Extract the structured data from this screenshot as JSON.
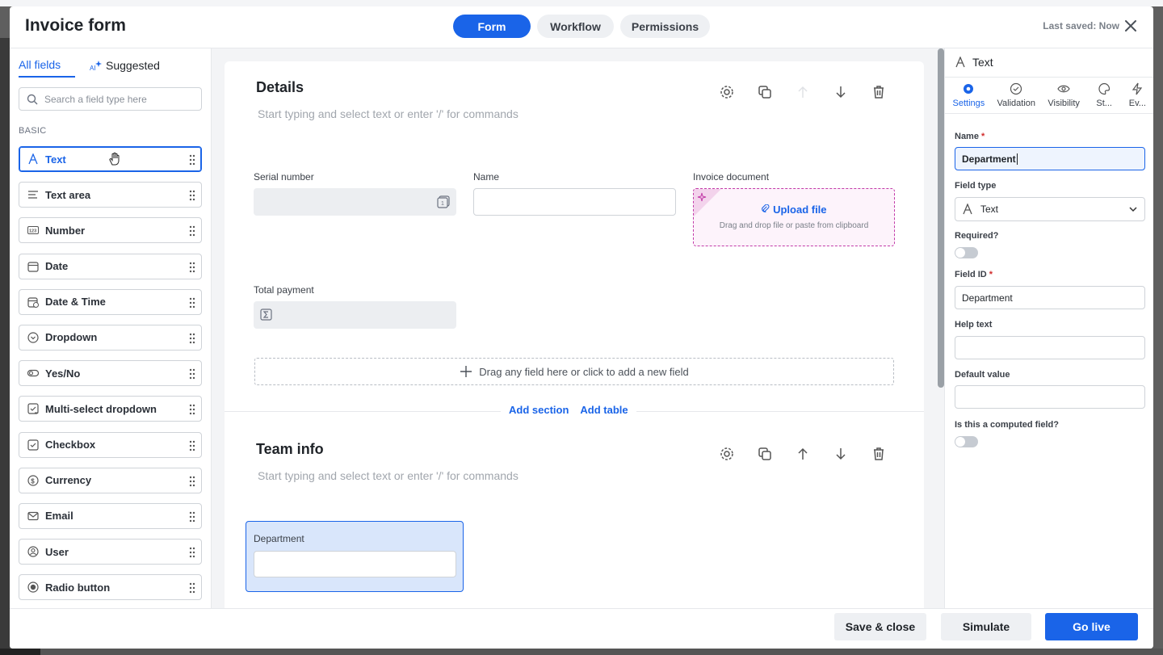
{
  "header": {
    "title": "Invoice form",
    "tabs": [
      {
        "label": "Form"
      },
      {
        "label": "Workflow"
      },
      {
        "label": "Permissions"
      }
    ],
    "last_saved": "Last saved: Now"
  },
  "left_panel": {
    "tabs": [
      {
        "label": "All fields"
      },
      {
        "label": "Suggested"
      }
    ],
    "search_placeholder": "Search a field type here",
    "section_label": "BASIC",
    "fields": [
      {
        "label": "Text",
        "icon": "text-icon"
      },
      {
        "label": "Text area",
        "icon": "text-area-icon"
      },
      {
        "label": "Number",
        "icon": "number-icon"
      },
      {
        "label": "Date",
        "icon": "date-icon"
      },
      {
        "label": "Date & Time",
        "icon": "date-time-icon"
      },
      {
        "label": "Dropdown",
        "icon": "dropdown-icon"
      },
      {
        "label": "Yes/No",
        "icon": "toggle-icon"
      },
      {
        "label": "Multi-select dropdown",
        "icon": "multi-select-icon"
      },
      {
        "label": "Checkbox",
        "icon": "checkbox-icon"
      },
      {
        "label": "Currency",
        "icon": "currency-icon"
      },
      {
        "label": "Email",
        "icon": "email-icon"
      },
      {
        "label": "User",
        "icon": "user-icon"
      },
      {
        "label": "Radio button",
        "icon": "radio-icon"
      }
    ]
  },
  "canvas": {
    "sections": [
      {
        "title": "Details",
        "hint": "Start typing and select text or enter '/' for commands",
        "fields": [
          {
            "label": "Serial number"
          },
          {
            "label": "Name"
          },
          {
            "label": "Invoice document"
          },
          {
            "label": "Total payment"
          }
        ],
        "upload_label": "Upload file",
        "upload_hint": "Drag and drop file or paste from clipboard",
        "dropzone": "Drag any field here or click to add a new field"
      },
      {
        "title": "Team info",
        "hint": "Start typing and select text or enter '/' for commands",
        "fields": [
          {
            "label": "Department"
          }
        ]
      }
    ],
    "add_section": "Add section",
    "add_table": "Add table"
  },
  "right_panel": {
    "title": "Text",
    "tabs": [
      {
        "label": "Settings",
        "icon": "gear-icon"
      },
      {
        "label": "Validation",
        "icon": "check-circle-icon"
      },
      {
        "label": "Visibility",
        "icon": "eye-icon"
      },
      {
        "label": "St...",
        "icon": "palette-icon"
      },
      {
        "label": "Ev...",
        "icon": "bolt-icon"
      }
    ],
    "name_label": "Name",
    "name_value": "Department",
    "field_type_label": "Field type",
    "field_type_value": "Text",
    "required_label": "Required?",
    "field_id_label": "Field ID",
    "field_id_value": "Department",
    "help_text_label": "Help text",
    "default_value_label": "Default value",
    "computed_label": "Is this a computed field?"
  },
  "footer": {
    "save_close": "Save & close",
    "simulate": "Simulate",
    "go_live": "Go live"
  },
  "colors": {
    "accent": "#1a64e8",
    "upload_border": "#c23aa8"
  }
}
